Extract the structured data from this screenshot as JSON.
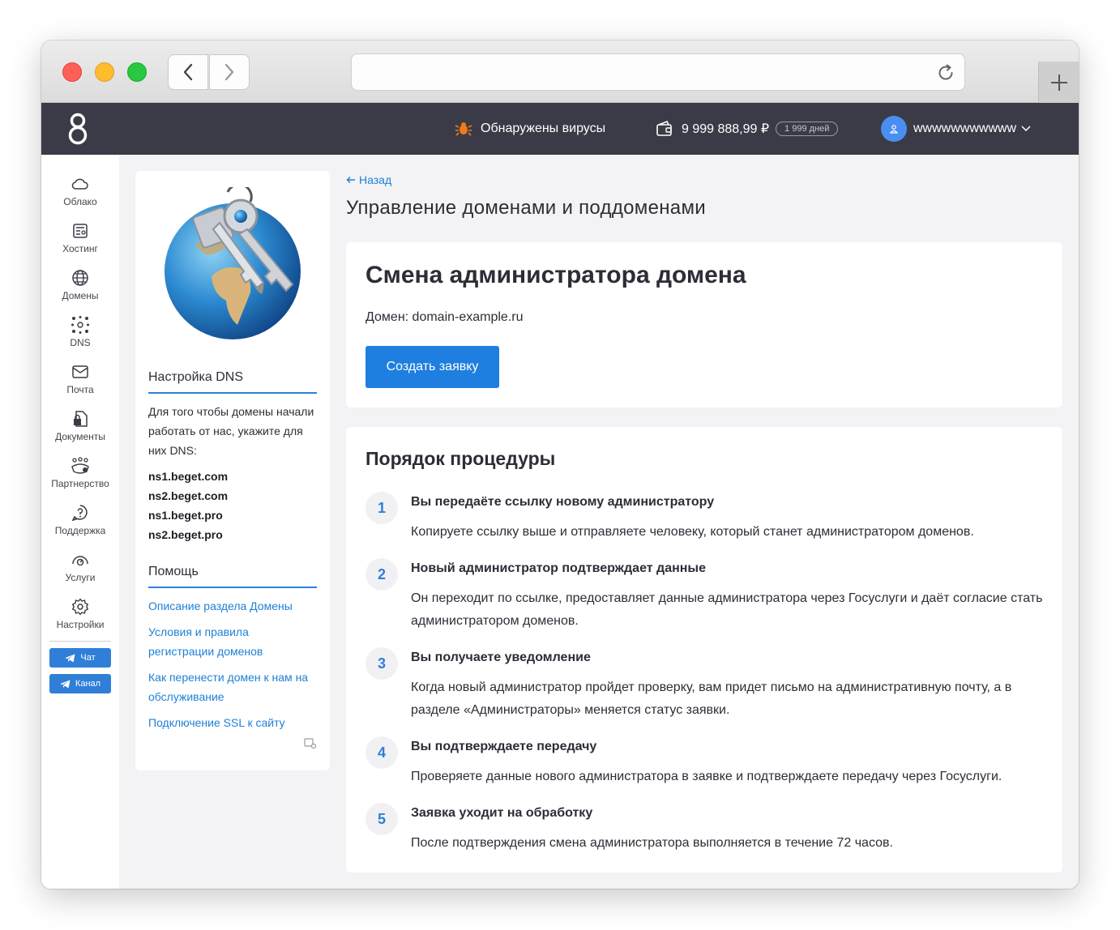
{
  "header": {
    "virus_alert": "Обнаружены вирусы",
    "balance": "9 999 888,99 ₽",
    "days_left": "1 999 дней",
    "username": "wwwwwwwwwww"
  },
  "sidebar": {
    "items": [
      {
        "label": "Облако",
        "icon": "cloud-icon"
      },
      {
        "label": "Хостинг",
        "icon": "hosting-icon"
      },
      {
        "label": "Домены",
        "icon": "globe-icon"
      },
      {
        "label": "DNS",
        "icon": "dns-icon"
      },
      {
        "label": "Почта",
        "icon": "mail-icon"
      },
      {
        "label": "Документы",
        "icon": "documents-icon"
      },
      {
        "label": "Партнерство",
        "icon": "partners-icon"
      },
      {
        "label": "Поддержка",
        "icon": "support-icon"
      },
      {
        "label": "Услуги",
        "icon": "services-icon"
      },
      {
        "label": "Настройки",
        "icon": "gear-icon"
      }
    ],
    "chat_label": "Чат",
    "channel_label": "Канал"
  },
  "info": {
    "dns_title": "Настройка DNS",
    "dns_text": "Для того чтобы домены начали работать от нас, укажите для них DNS:",
    "ns": [
      "ns1.beget.com",
      "ns2.beget.com",
      "ns1.beget.pro",
      "ns2.beget.pro"
    ],
    "help_title": "Помощь",
    "help_links": [
      "Описание раздела Домены",
      "Условия и правила регистрации доменов",
      "Как перенести домен к нам на обслуживание",
      "Подключение SSL к сайту"
    ]
  },
  "main": {
    "back": "Назад",
    "page_title": "Управление доменами и поддоменами",
    "card_title": "Смена администратора домена",
    "domain_line": "Домен: domain-example.ru",
    "create_button": "Создать заявку",
    "procedure_title": "Порядок процедуры",
    "steps": [
      {
        "num": "1",
        "title": "Вы передаёте ссылку новому администратору",
        "desc": "Копируете ссылку выше и отправляете человеку, который станет администратором доменов."
      },
      {
        "num": "2",
        "title": "Новый администратор подтверждает данные",
        "desc": "Он переходит по ссылке, предоставляет данные администратора через Госуслуги и даёт согласие стать администратором доменов."
      },
      {
        "num": "3",
        "title": "Вы получаете уведомление",
        "desc": "Когда новый администратор пройдет проверку, вам придет письмо на административную почту, а в разделе «Администраторы» меняется статус заявки."
      },
      {
        "num": "4",
        "title": "Вы подтверждаете передачу",
        "desc": "Проверяете данные нового администратора в заявке и подтверждаете передачу через Госуслуги."
      },
      {
        "num": "5",
        "title": "Заявка уходит на обработку",
        "desc": "После подтверждения смена администратора выполняется в течение 72 часов."
      }
    ]
  },
  "colors": {
    "accent": "#1f7fe0",
    "header_bg": "#3b3b47",
    "page_bg": "#f3f3f5"
  }
}
